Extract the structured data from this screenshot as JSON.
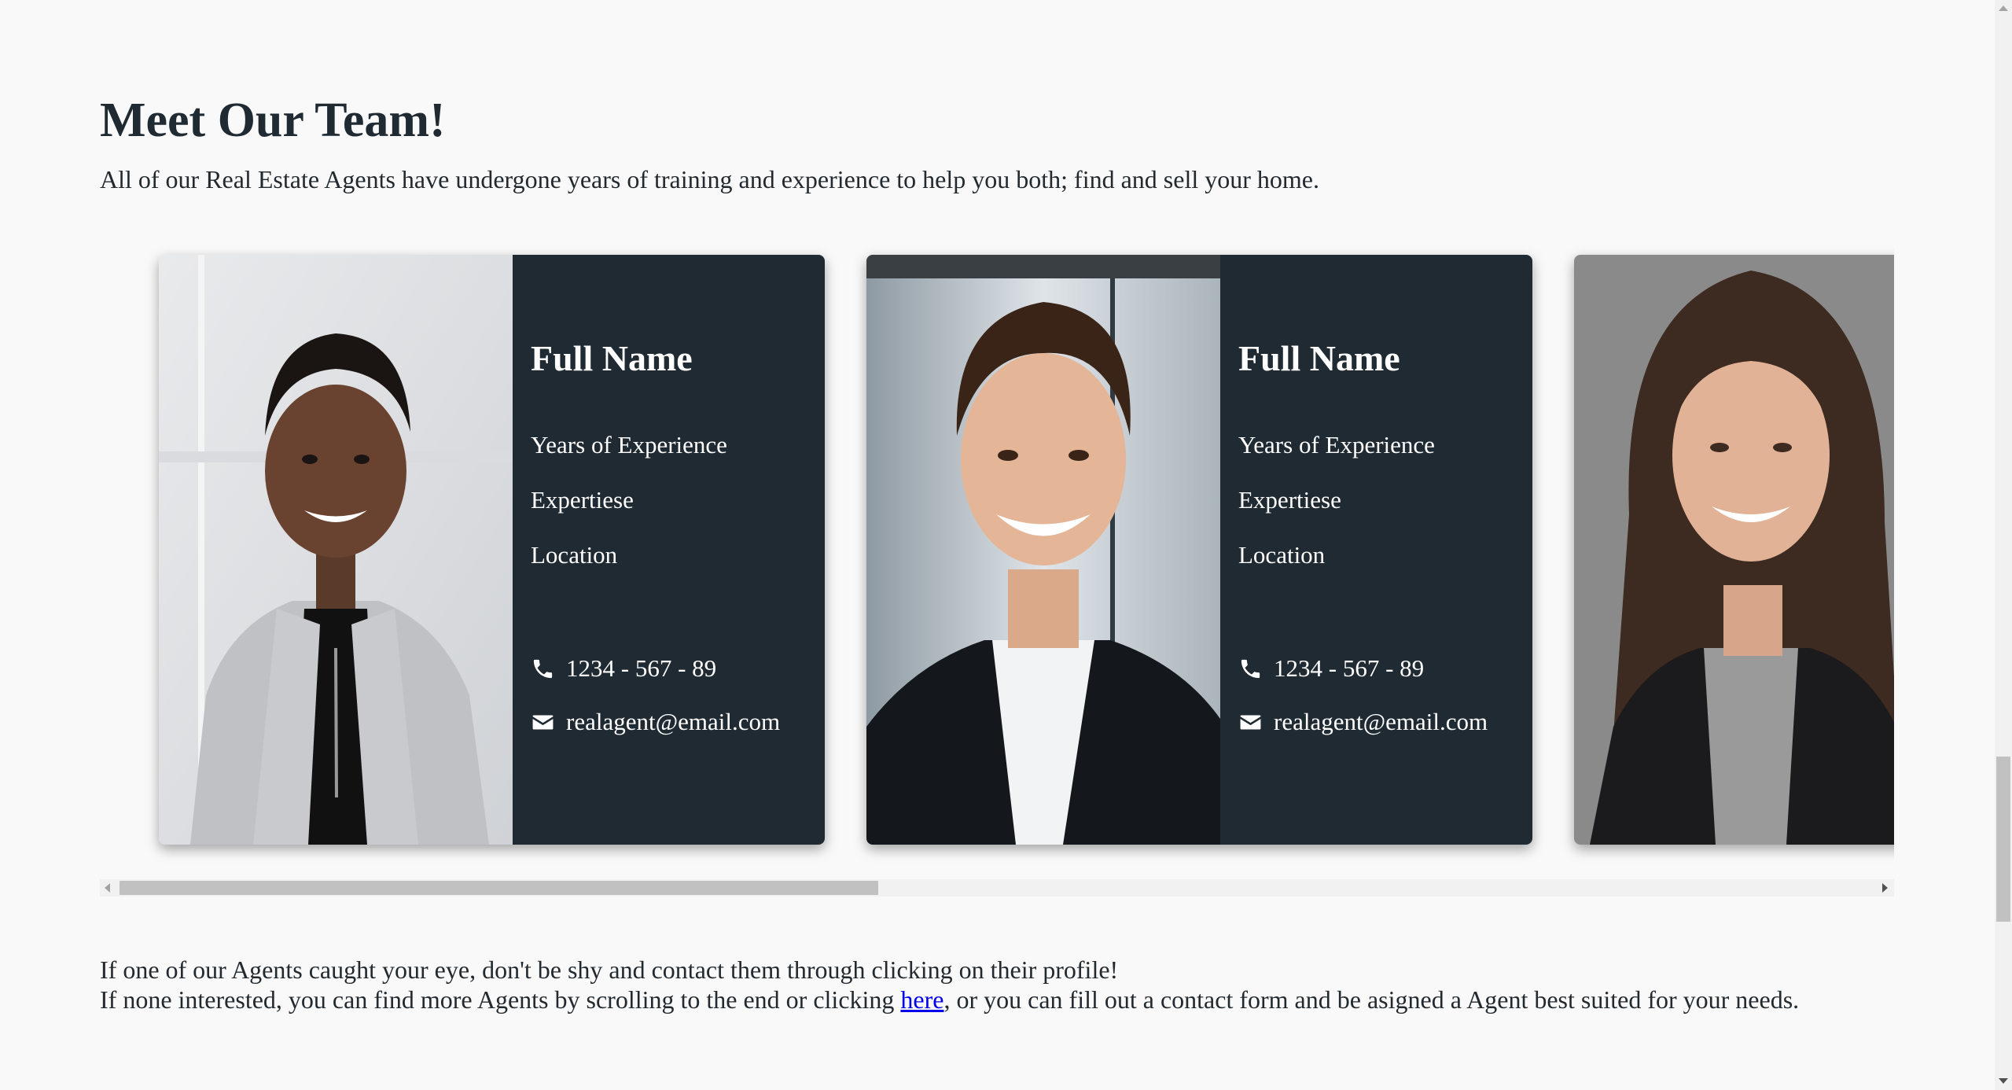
{
  "section": {
    "title": "Meet Our Team!",
    "subtitle": "All of our Real Estate Agents have undergone years of training and experience to help you both; find and sell your home."
  },
  "agents": [
    {
      "name": "Full Name",
      "experience": "Years of Experience",
      "expertise": "Expertiese",
      "location": "Location",
      "phone": "1234 - 567 - 89",
      "email": "realagent@email.com",
      "photo_icon": "portrait-woman-grey-blazer"
    },
    {
      "name": "Full Name",
      "experience": "Years of Experience",
      "expertise": "Expertiese",
      "location": "Location",
      "phone": "1234 - 567 - 89",
      "email": "realagent@email.com",
      "photo_icon": "portrait-man-dark-jacket"
    },
    {
      "photo_icon": "portrait-woman-black-blazer"
    }
  ],
  "footer": {
    "line1": "If one of our Agents caught your eye, don't be shy and contact them through clicking on their profile!",
    "line2_before": "If none interested, you can find more Agents by scrolling to the end or clicking ",
    "line2_link": "here",
    "line2_after": ", or you can fill out a contact form and be asigned a Agent best suited for your needs."
  },
  "icons": {
    "phone": "phone-icon",
    "email": "envelope-icon"
  },
  "colors": {
    "card_info_bg": "#1f2a32",
    "page_bg": "#f9f9f9",
    "link": "#0000ee"
  },
  "scroll": {
    "horizontal_thumb_fraction": 0.42,
    "vertical_position_fraction": 0.78
  }
}
